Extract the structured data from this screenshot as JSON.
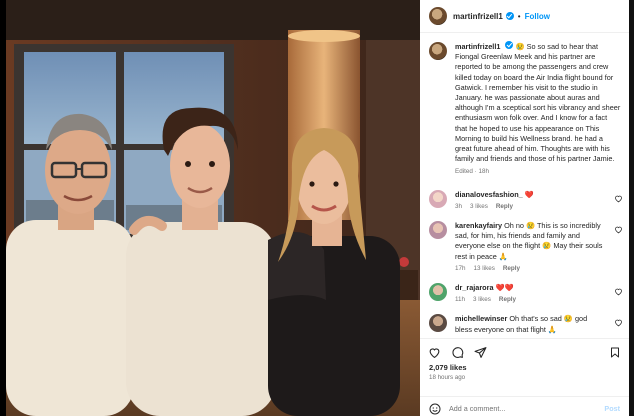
{
  "post": {
    "username": "martinfrizell1",
    "follow_label": "Follow",
    "separator": "•",
    "caption": "So so sad to hear that Fiongal Greenlaw Meek and his partner are reported to be among the passengers and crew killed today on board the Air India flight bound for Gatwick. I remember his visit to the studio in January. he was passionate about auras and although I'm a sceptical sort his vibrancy and sheer enthusiasm won folk over. And I know for a fact that he hoped to use his appearance on This Morning to build his Wellness brand. he had a great future ahead of him. Thoughts are with his family and friends and those of his partner Jamie.",
    "edited": "Edited · 18h",
    "caption_emoji": "😢"
  },
  "comments": [
    {
      "user": "dianalovesfashion_",
      "text": "",
      "emoji": "❤️",
      "time": "3h",
      "likes": "3 likes",
      "reply": "Reply",
      "avatar_color": "#d8a9b5"
    },
    {
      "user": "karenkayfairy",
      "text": "Oh no 😢 This is so incredibly sad, for him, his friends and family and everyone else on the flight 😢 May their souls rest in peace 🙏",
      "emoji": "",
      "time": "17h",
      "likes": "13 likes",
      "reply": "Reply",
      "avatar_color": "#b78ea0"
    },
    {
      "user": "dr_rajarora",
      "text": "",
      "emoji": "❤️❤️",
      "time": "11h",
      "likes": "3 likes",
      "reply": "Reply",
      "avatar_color": "#4fa36a"
    },
    {
      "user": "michellewinser",
      "text": "Oh that's so sad 😢 god bless everyone on that flight 🙏",
      "emoji": "",
      "time": "",
      "likes": "",
      "reply": "",
      "avatar_color": "#5a4a42"
    }
  ],
  "footer": {
    "likes": "2,079 likes",
    "ago": "18 hours ago",
    "add_comment_placeholder": "Add a comment...",
    "post_label": "Post"
  },
  "colors": {
    "link": "#0095f6",
    "heart_red": "#ed4956",
    "muted": "#737373"
  }
}
